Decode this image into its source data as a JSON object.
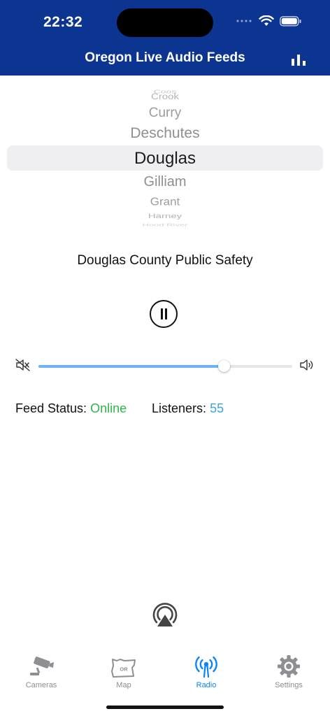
{
  "status_bar": {
    "time": "22:32"
  },
  "nav": {
    "title": "Oregon Live Audio Feeds",
    "action_icon": "bar-chart-icon"
  },
  "picker": {
    "items": [
      "Coos",
      "Crook",
      "Curry",
      "Deschutes",
      "Douglas",
      "Gilliam",
      "Grant",
      "Harney",
      "Hood River"
    ],
    "selected": "Douglas"
  },
  "feed": {
    "title": "Douglas County Public Safety",
    "playback_state": "playing",
    "volume_fraction": 0.73
  },
  "info": {
    "status_label": "Feed Status:",
    "status_value": "Online",
    "listeners_label": "Listeners:",
    "listeners_value": "55"
  },
  "colors": {
    "header_bg": "#0b3591",
    "online": "#2fb54b",
    "listeners": "#3aa7d9",
    "active_tab": "#0a84ff",
    "slider_fill": "#6cb4f7"
  },
  "tabs": [
    {
      "label": "Cameras",
      "icon": "camera-icon",
      "active": false
    },
    {
      "label": "Map",
      "icon": "oregon-map-icon",
      "active": false
    },
    {
      "label": "Radio",
      "icon": "radio-antenna-icon",
      "active": true
    },
    {
      "label": "Settings",
      "icon": "gear-icon",
      "active": false
    }
  ]
}
